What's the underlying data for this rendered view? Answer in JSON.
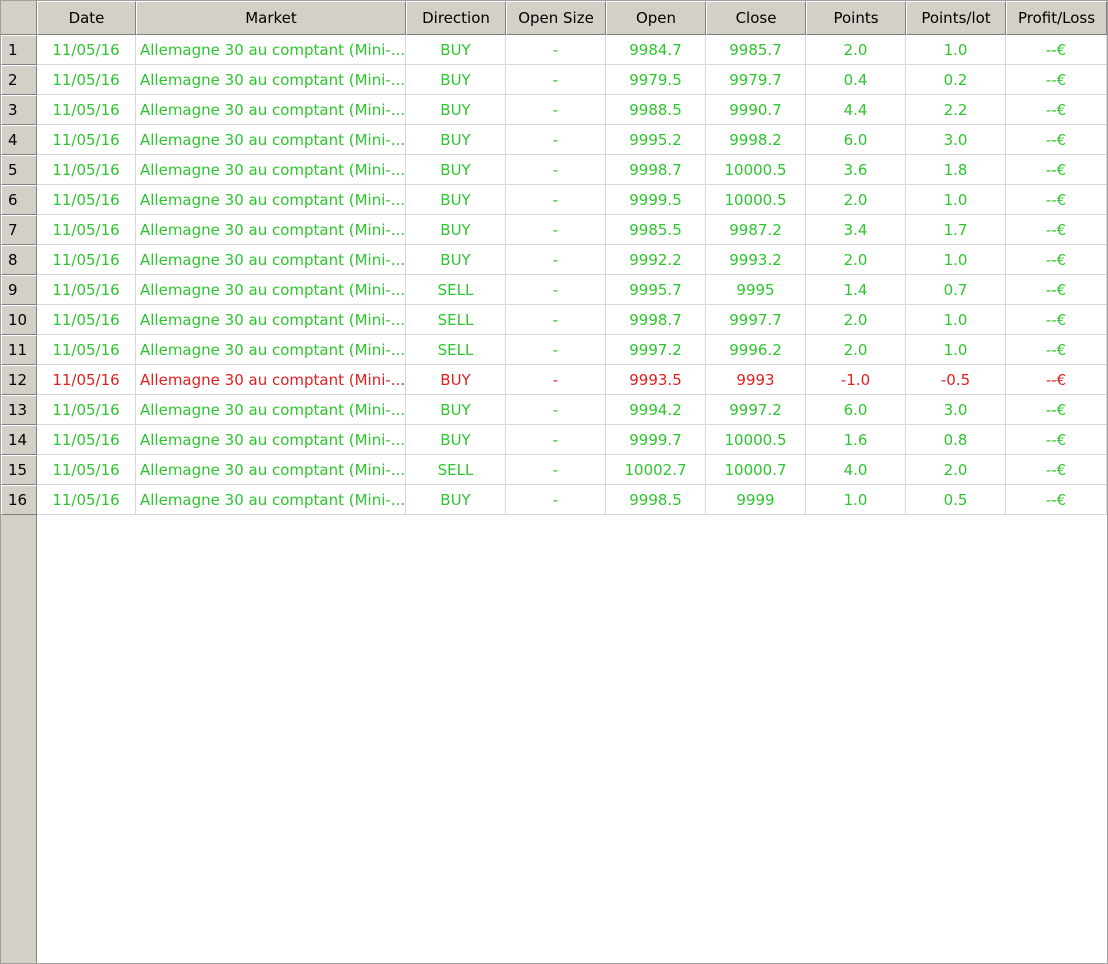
{
  "columns": [
    "Date",
    "Market",
    "Direction",
    "Open Size",
    "Open",
    "Close",
    "Points",
    "Points/lot",
    "Profit/Loss"
  ],
  "colors": {
    "profit": "#2ec52e",
    "loss": "#e02020"
  },
  "rows": [
    {
      "n": "1",
      "date": "11/05/16",
      "market": "Allemagne 30 au comptant (Mini-...",
      "direction": "BUY",
      "open_size": "-",
      "open": "9984.7",
      "close": "9985.7",
      "points": "2.0",
      "points_lot": "1.0",
      "pl": "--€",
      "status": "win"
    },
    {
      "n": "2",
      "date": "11/05/16",
      "market": "Allemagne 30 au comptant (Mini-...",
      "direction": "BUY",
      "open_size": "-",
      "open": "9979.5",
      "close": "9979.7",
      "points": "0.4",
      "points_lot": "0.2",
      "pl": "--€",
      "status": "win"
    },
    {
      "n": "3",
      "date": "11/05/16",
      "market": "Allemagne 30 au comptant (Mini-...",
      "direction": "BUY",
      "open_size": "-",
      "open": "9988.5",
      "close": "9990.7",
      "points": "4.4",
      "points_lot": "2.2",
      "pl": "--€",
      "status": "win"
    },
    {
      "n": "4",
      "date": "11/05/16",
      "market": "Allemagne 30 au comptant (Mini-...",
      "direction": "BUY",
      "open_size": "-",
      "open": "9995.2",
      "close": "9998.2",
      "points": "6.0",
      "points_lot": "3.0",
      "pl": "--€",
      "status": "win"
    },
    {
      "n": "5",
      "date": "11/05/16",
      "market": "Allemagne 30 au comptant (Mini-...",
      "direction": "BUY",
      "open_size": "-",
      "open": "9998.7",
      "close": "10000.5",
      "points": "3.6",
      "points_lot": "1.8",
      "pl": "--€",
      "status": "win"
    },
    {
      "n": "6",
      "date": "11/05/16",
      "market": "Allemagne 30 au comptant (Mini-...",
      "direction": "BUY",
      "open_size": "-",
      "open": "9999.5",
      "close": "10000.5",
      "points": "2.0",
      "points_lot": "1.0",
      "pl": "--€",
      "status": "win"
    },
    {
      "n": "7",
      "date": "11/05/16",
      "market": "Allemagne 30 au comptant (Mini-...",
      "direction": "BUY",
      "open_size": "-",
      "open": "9985.5",
      "close": "9987.2",
      "points": "3.4",
      "points_lot": "1.7",
      "pl": "--€",
      "status": "win"
    },
    {
      "n": "8",
      "date": "11/05/16",
      "market": "Allemagne 30 au comptant (Mini-...",
      "direction": "BUY",
      "open_size": "-",
      "open": "9992.2",
      "close": "9993.2",
      "points": "2.0",
      "points_lot": "1.0",
      "pl": "--€",
      "status": "win"
    },
    {
      "n": "9",
      "date": "11/05/16",
      "market": "Allemagne 30 au comptant (Mini-...",
      "direction": "SELL",
      "open_size": "-",
      "open": "9995.7",
      "close": "9995",
      "points": "1.4",
      "points_lot": "0.7",
      "pl": "--€",
      "status": "win"
    },
    {
      "n": "10",
      "date": "11/05/16",
      "market": "Allemagne 30 au comptant (Mini-...",
      "direction": "SELL",
      "open_size": "-",
      "open": "9998.7",
      "close": "9997.7",
      "points": "2.0",
      "points_lot": "1.0",
      "pl": "--€",
      "status": "win"
    },
    {
      "n": "11",
      "date": "11/05/16",
      "market": "Allemagne 30 au comptant (Mini-...",
      "direction": "SELL",
      "open_size": "-",
      "open": "9997.2",
      "close": "9996.2",
      "points": "2.0",
      "points_lot": "1.0",
      "pl": "--€",
      "status": "win"
    },
    {
      "n": "12",
      "date": "11/05/16",
      "market": "Allemagne 30 au comptant (Mini-...",
      "direction": "BUY",
      "open_size": "-",
      "open": "9993.5",
      "close": "9993",
      "points": "-1.0",
      "points_lot": "-0.5",
      "pl": "--€",
      "status": "loss"
    },
    {
      "n": "13",
      "date": "11/05/16",
      "market": "Allemagne 30 au comptant (Mini-...",
      "direction": "BUY",
      "open_size": "-",
      "open": "9994.2",
      "close": "9997.2",
      "points": "6.0",
      "points_lot": "3.0",
      "pl": "--€",
      "status": "win"
    },
    {
      "n": "14",
      "date": "11/05/16",
      "market": "Allemagne 30 au comptant (Mini-...",
      "direction": "BUY",
      "open_size": "-",
      "open": "9999.7",
      "close": "10000.5",
      "points": "1.6",
      "points_lot": "0.8",
      "pl": "--€",
      "status": "win"
    },
    {
      "n": "15",
      "date": "11/05/16",
      "market": "Allemagne 30 au comptant (Mini-...",
      "direction": "SELL",
      "open_size": "-",
      "open": "10002.7",
      "close": "10000.7",
      "points": "4.0",
      "points_lot": "2.0",
      "pl": "--€",
      "status": "win"
    },
    {
      "n": "16",
      "date": "11/05/16",
      "market": "Allemagne 30 au comptant (Mini-...",
      "direction": "BUY",
      "open_size": "-",
      "open": "9998.5",
      "close": "9999",
      "points": "1.0",
      "points_lot": "0.5",
      "pl": "--€",
      "status": "win"
    }
  ]
}
